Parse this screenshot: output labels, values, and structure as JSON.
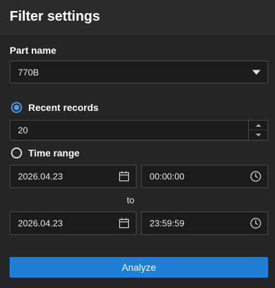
{
  "panel": {
    "title": "Filter settings"
  },
  "part_name": {
    "label": "Part name",
    "selected": "770B"
  },
  "recent_records": {
    "label": "Recent records",
    "value": "20",
    "selected": true
  },
  "time_range": {
    "label": "Time range",
    "selected": false,
    "start_date": "2026.04.23",
    "start_time": "00:00:00",
    "separator": "to",
    "end_date": "2026.04.23",
    "end_time": "23:59:59"
  },
  "actions": {
    "analyze_label": "Analyze"
  },
  "colors": {
    "accent": "#1e7fd6",
    "radio_selected": "#4a9ae0",
    "background": "#252526",
    "field": "#1b1b1b"
  },
  "icons": {
    "dropdown": "chevron-down-icon",
    "date": "calendar-icon",
    "time": "clock-icon"
  }
}
